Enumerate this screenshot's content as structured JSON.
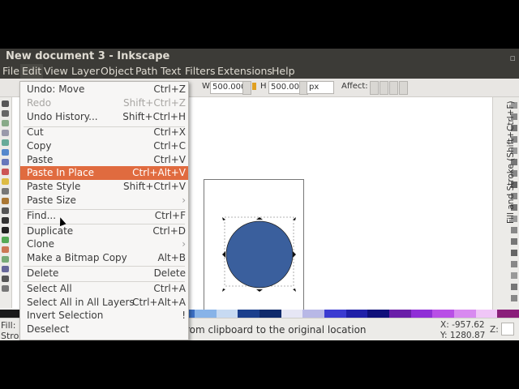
{
  "window": {
    "title": "New document 3 - Inkscape"
  },
  "menubar": [
    "File",
    "Edit",
    "View",
    "Layer",
    "Object",
    "Path",
    "Text",
    "Filters",
    "Extensions",
    "Help"
  ],
  "toolbar": {
    "w_label": "W",
    "w_value": "500.000",
    "h_label": "H",
    "h_value": "500.000",
    "unit": "px",
    "affect_label": "Affect:",
    "partial_z_label": "Z"
  },
  "edit_menu": {
    "items": [
      {
        "label": "Undo: Move",
        "shortcut": "Ctrl+Z",
        "enabled": true
      },
      {
        "label": "Redo",
        "shortcut": "Shift+Ctrl+Z",
        "enabled": false
      },
      {
        "label": "Undo History...",
        "shortcut": "Shift+Ctrl+H",
        "enabled": true
      },
      {
        "label": "Cut",
        "shortcut": "Ctrl+X",
        "enabled": true
      },
      {
        "label": "Copy",
        "shortcut": "Ctrl+C",
        "enabled": true
      },
      {
        "label": "Paste",
        "shortcut": "Ctrl+V",
        "enabled": true
      },
      {
        "label": "Paste In Place",
        "shortcut": "Ctrl+Alt+V",
        "enabled": true,
        "highlighted": true
      },
      {
        "label": "Paste Style",
        "shortcut": "Shift+Ctrl+V",
        "enabled": true
      },
      {
        "label": "Paste Size",
        "shortcut": "",
        "enabled": true
      },
      {
        "label": "Find...",
        "shortcut": "Ctrl+F",
        "enabled": true
      },
      {
        "label": "Duplicate",
        "shortcut": "Ctrl+D",
        "enabled": true
      },
      {
        "label": "Clone",
        "shortcut": "",
        "enabled": true
      },
      {
        "label": "Make a Bitmap Copy",
        "shortcut": "Alt+B",
        "enabled": true
      },
      {
        "label": "Delete",
        "shortcut": "Delete",
        "enabled": true
      },
      {
        "label": "Select All",
        "shortcut": "Ctrl+A",
        "enabled": true
      },
      {
        "label": "Select All in All Layers",
        "shortcut": "Ctrl+Alt+A",
        "enabled": true
      },
      {
        "label": "Invert Selection",
        "shortcut": "!",
        "enabled": true
      },
      {
        "label": "Deselect",
        "shortcut": "",
        "enabled": true
      }
    ]
  },
  "right_panel": {
    "title": "Fill and Stroke (Shift+Ctrl+F)"
  },
  "statusbar": {
    "fill_label": "Fill:",
    "stroke_label": "Strok",
    "message": "rom clipboard to the original location",
    "x_coord": "X: -957.62",
    "y_coord": "Y: 1280.87",
    "z_label": "Z:"
  },
  "colors": {
    "circle_fill": "#3a5f9d",
    "menu_highlight": "#e06b3f",
    "titlebar_bg": "#3c3b37"
  }
}
